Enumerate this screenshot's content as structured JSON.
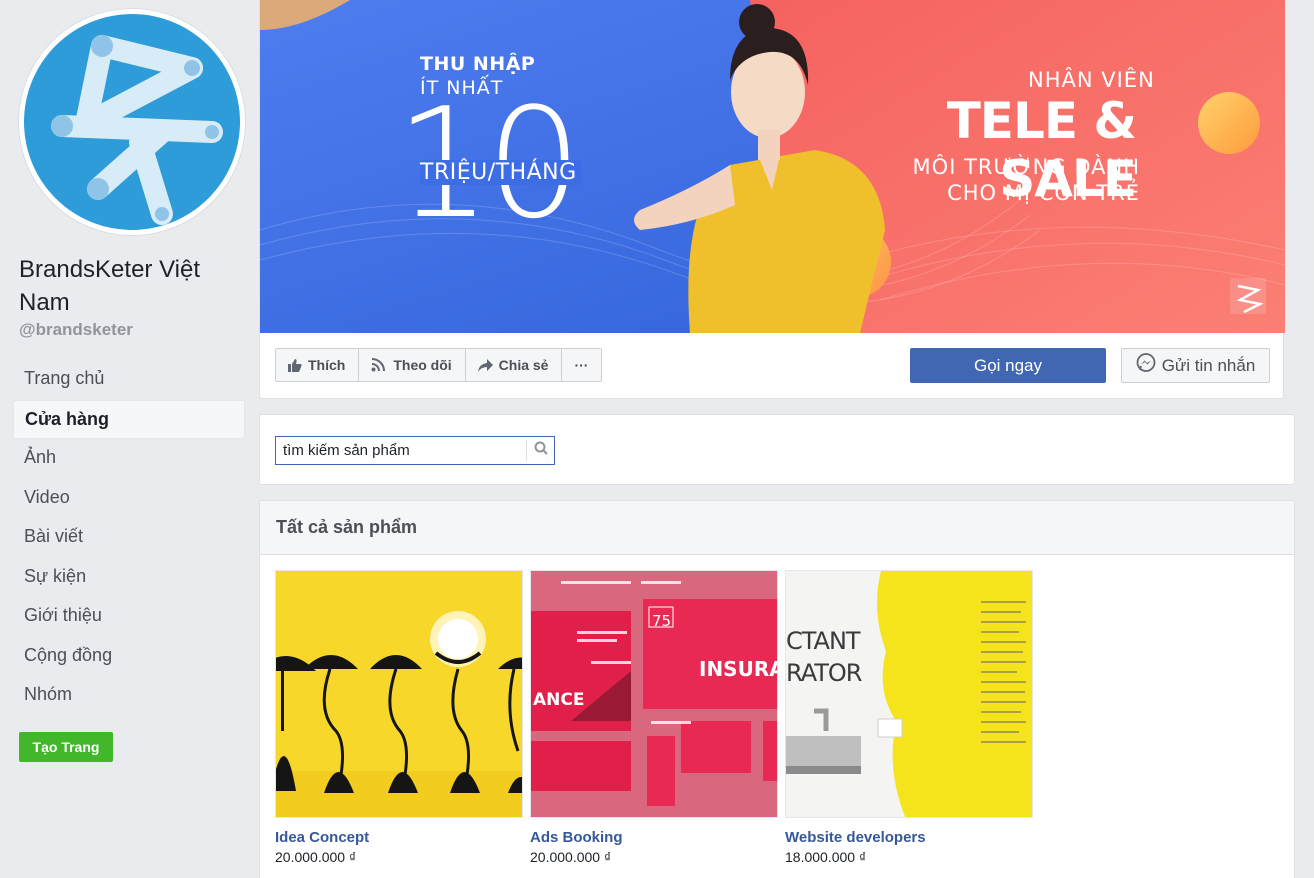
{
  "page": {
    "name": "BrandsKeter Việt Nam",
    "handle": "@brandsketer"
  },
  "nav": [
    {
      "label": "Trang chủ"
    },
    {
      "label": "Cửa hàng"
    },
    {
      "label": "Ảnh"
    },
    {
      "label": "Video"
    },
    {
      "label": "Bài viết"
    },
    {
      "label": "Sự kiện"
    },
    {
      "label": "Giới thiệu"
    },
    {
      "label": "Cộng đồng"
    },
    {
      "label": "Nhóm"
    }
  ],
  "create_page_label": "Tạo Trang",
  "cover": {
    "income_title": "THU NHẬP",
    "income_min": "ÍT NHẤT",
    "income_amount": "10",
    "income_unit": "TRIỆU/THÁNG",
    "role_label": "NHÂN VIÊN",
    "role_title": "TELE & SALE",
    "env_line1": "MÔI TRƯỜNG DÀNH",
    "env_line2": "CHO MỊ CÒN TRẺ"
  },
  "actions": {
    "like": "Thích",
    "follow": "Theo dõi",
    "share": "Chia sẻ",
    "more": "···",
    "call": "Gọi ngay",
    "message": "Gửi tin nhắn"
  },
  "search": {
    "value": "tìm kiếm sản phẩm"
  },
  "products": {
    "heading": "Tất cả sản phẩm",
    "items": [
      {
        "name": "Idea Concept",
        "price": "20.000.000 ₫"
      },
      {
        "name": "Ads Booking",
        "price": "20.000.000 ₫"
      },
      {
        "name": "Website developers",
        "price": "18.000.000 ₫"
      }
    ],
    "thumb_texts": {
      "ads_75": "75",
      "ads_insurance": "INSURANCE",
      "ads_ance": "ANCE",
      "web_ctant": "CTANT",
      "web_rator": "RATOR"
    }
  },
  "colors": {
    "facebook_blue": "#4267b2",
    "link_blue": "#365899",
    "green": "#42b72a",
    "cover_blue": "#3d6de4",
    "cover_coral": "#f76a6a"
  }
}
